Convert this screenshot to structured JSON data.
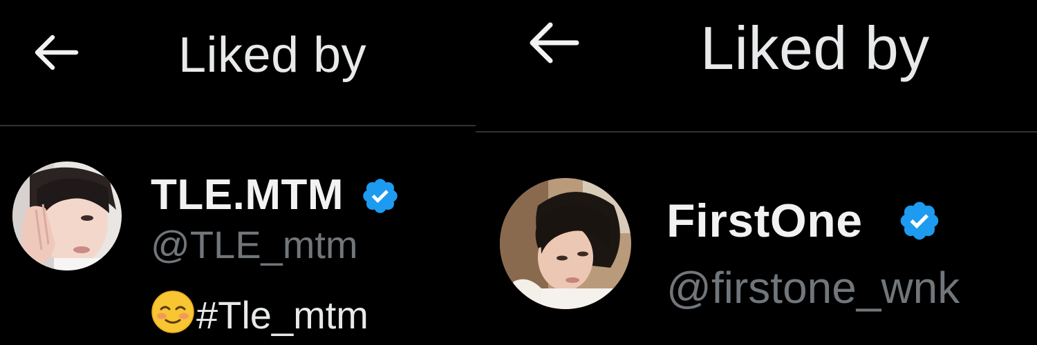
{
  "panels": [
    {
      "header": {
        "back_icon": "arrow-left-icon",
        "title": "Liked by"
      },
      "user": {
        "display_name": "TLE.MTM",
        "verified_icon": "verified-badge-icon",
        "verified_color": "#1d9bf0",
        "handle": "@TLE_mtm",
        "bio_emoji": "smiling-face-with-smiling-eyes-emoji",
        "bio_text": "#Tle_mtm"
      }
    },
    {
      "header": {
        "back_icon": "arrow-left-icon",
        "title": "Liked by"
      },
      "user": {
        "display_name": "FirstOne",
        "verified_icon": "verified-badge-icon",
        "verified_color": "#1d9bf0",
        "handle": "@firstone_wnk"
      }
    }
  ],
  "colors": {
    "background": "#000000",
    "primary_text": "#e7e9ea",
    "secondary_text": "#71767b",
    "divider": "#2f3336",
    "verified_blue": "#1d9bf0"
  }
}
